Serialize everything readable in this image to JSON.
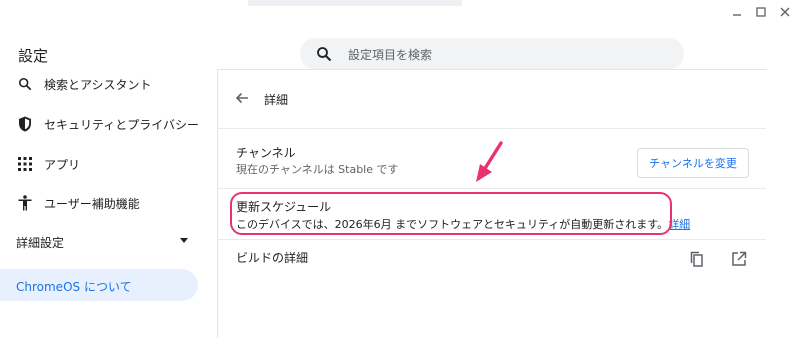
{
  "app": {
    "title": "設定"
  },
  "search": {
    "placeholder": "設定項目を検索"
  },
  "sidebar": {
    "items": [
      {
        "label": "検索とアシスタント",
        "icon": "search-icon"
      },
      {
        "label": "セキュリティとプライバシー",
        "icon": "shield-icon"
      },
      {
        "label": "アプリ",
        "icon": "apps-grid-icon"
      },
      {
        "label": "ユーザー補助機能",
        "icon": "accessibility-icon"
      }
    ],
    "advanced_label": "詳細設定",
    "about_label": "ChromeOS について"
  },
  "page": {
    "title": "詳細",
    "channel": {
      "title": "チャンネル",
      "subtitle": "現在のチャンネルは Stable です",
      "button": "チャンネルを変更"
    },
    "update_schedule": {
      "title": "更新スケジュール",
      "text": "このデバイスでは、2026年6月 までソフトウェアとセキュリティが自動更新されます。",
      "link": "詳細"
    },
    "build_details": {
      "title": "ビルドの詳細"
    }
  },
  "colors": {
    "accent": "#1a73e8",
    "highlight": "#e8336f",
    "selected_bg": "#e8f0fe"
  }
}
